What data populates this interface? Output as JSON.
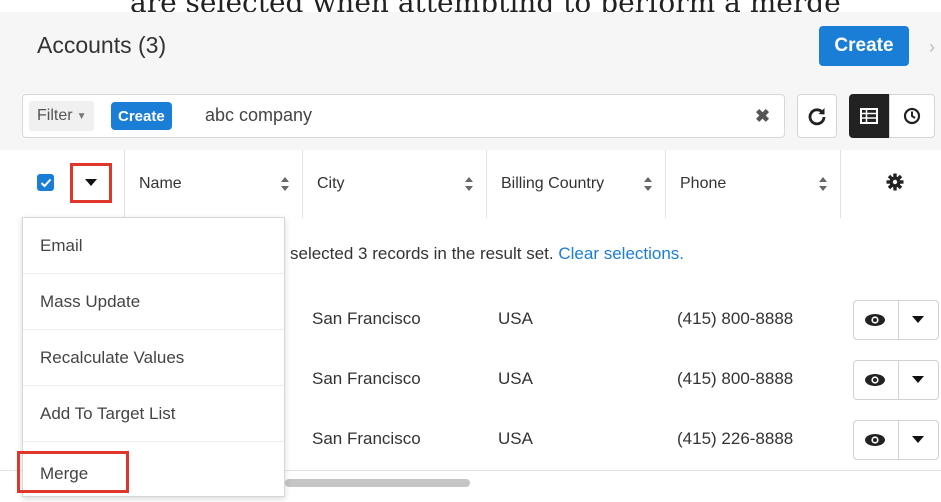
{
  "caption": "are selected when attempting to perform a merge",
  "header": {
    "title": "Accounts (3)",
    "create_label": "Create",
    "chevron": "›"
  },
  "filter": {
    "dropdown_label": "Filter",
    "create_label": "Create",
    "search_value": "abc company",
    "clear_symbol": "✖"
  },
  "toolbar": {
    "refresh_icon": "refresh-icon",
    "list_view_icon": "list-view-icon",
    "activity_icon": "clock-icon"
  },
  "columns": [
    {
      "label": "Name",
      "sortable": true
    },
    {
      "label": "City",
      "sortable": true
    },
    {
      "label": "Billing Country",
      "sortable": true
    },
    {
      "label": "Phone",
      "sortable": true
    }
  ],
  "alert": {
    "text": "selected 3 records in the result set. ",
    "link": "Clear selections."
  },
  "rows": [
    {
      "city": "San Francisco",
      "country": "USA",
      "phone": "(415) 800-8888"
    },
    {
      "city": "San Francisco",
      "country": "USA",
      "phone": "(415) 800-8888"
    },
    {
      "city": "San Francisco",
      "country": "USA",
      "phone": "(415) 226-8888"
    }
  ],
  "mass_actions_menu": [
    {
      "label": "Email"
    },
    {
      "label": "Mass Update"
    },
    {
      "label": "Recalculate Values"
    },
    {
      "label": "Add To Target List"
    },
    {
      "label": "Merge",
      "highlighted": true
    }
  ],
  "colors": {
    "accent": "#1a7ed6",
    "highlight": "#e0352b"
  }
}
